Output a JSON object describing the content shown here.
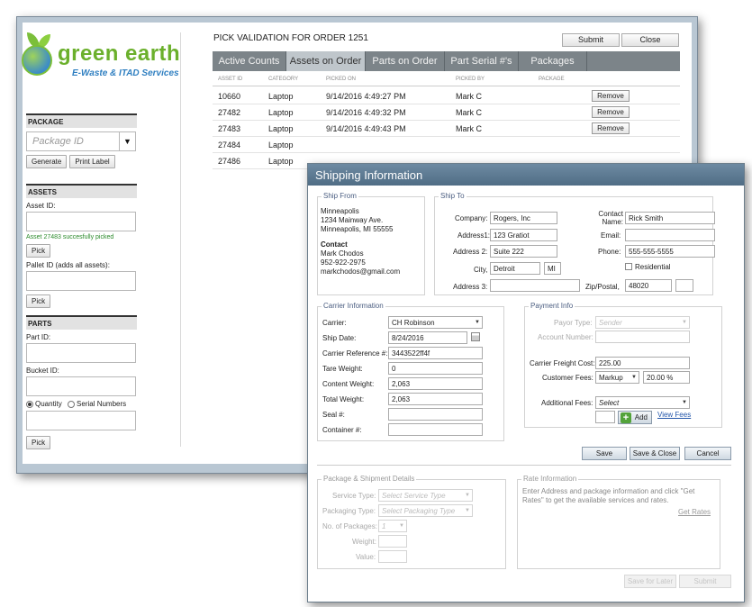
{
  "main": {
    "brand_name": "green earth",
    "brand_tagline": "E-Waste & ITAD Services",
    "order_title": "PICK VALIDATION FOR ORDER 1251",
    "submit_label": "Submit",
    "close_label": "Close",
    "tabs": [
      "Active Counts",
      "Assets on Order",
      "Parts on Order",
      "Part Serial #'s",
      "Packages"
    ],
    "grid_headers": [
      "ASSET ID",
      "CATEGORY",
      "PICKED ON",
      "PICKED BY",
      "PACKAGE"
    ],
    "remove_label": "Remove",
    "rows": [
      {
        "asset_id": "10660",
        "category": "Laptop",
        "picked_on": "9/14/2016 4:49:27 PM",
        "picked_by": "Mark C",
        "removable": true
      },
      {
        "asset_id": "27482",
        "category": "Laptop",
        "picked_on": "9/14/2016 4:49:32 PM",
        "picked_by": "Mark C",
        "removable": true
      },
      {
        "asset_id": "27483",
        "category": "Laptop",
        "picked_on": "9/14/2016 4:49:43 PM",
        "picked_by": "Mark C",
        "removable": true
      },
      {
        "asset_id": "27484",
        "category": "Laptop",
        "picked_on": "",
        "picked_by": "",
        "removable": false
      },
      {
        "asset_id": "27486",
        "category": "Laptop",
        "picked_on": "",
        "picked_by": "",
        "removable": false
      }
    ]
  },
  "sidebar": {
    "package": {
      "heading": "PACKAGE",
      "placeholder": "Package ID",
      "generate": "Generate",
      "print_label": "Print Label"
    },
    "assets": {
      "heading": "ASSETS",
      "asset_label": "Asset ID:",
      "success": "Asset 27483 succesfully picked",
      "pick": "Pick",
      "pallet_label": "Pallet ID (adds all assets):"
    },
    "parts": {
      "heading": "PARTS",
      "part_label": "Part ID:",
      "bucket_label": "Bucket ID:",
      "quantity": "Quantity",
      "serial": "Serial Numbers",
      "pick": "Pick"
    }
  },
  "dialog": {
    "title": "Shipping Information",
    "ship_from": {
      "title": "Ship From",
      "line1": "Minneapolis",
      "line2": "1234 Mainway Ave.",
      "line3": "Minneapolis, MI 55555",
      "contact_heading": "Contact",
      "contact_name": "Mark Chodos",
      "contact_phone": "952-922-2975",
      "contact_email": "markchodos@gmail.com"
    },
    "ship_to": {
      "title": "Ship To",
      "company_label": "Company:",
      "company": "Rogers, Inc",
      "contact_label": "Contact Name:",
      "contact": "Rick Smith",
      "address1_label": "Address1:",
      "address1": "123 Gratiot",
      "email_label": "Email:",
      "email": "",
      "address2_label": "Address 2:",
      "address2": "Suite 222",
      "phone_label": "Phone:",
      "phone": "555-555-5555",
      "city_label": "City,",
      "city": "Detroit",
      "state": "MI",
      "residential_label": "Residential",
      "address3_label": "Address 3:",
      "address3": "",
      "zip_label": "Zip/Postal,",
      "zip": "48020"
    },
    "carrier": {
      "title": "Carrier Information",
      "carrier_label": "Carrier:",
      "carrier": "CH Robinson",
      "ship_date_label": "Ship Date:",
      "ship_date": "8/24/2016",
      "ref_label": "Carrier Reference #:",
      "ref": "3443522ff4f",
      "tare_label": "Tare Weight:",
      "tare": "0",
      "content_label": "Content Weight:",
      "content": "2,063",
      "total_label": "Total Weight:",
      "total": "2,063",
      "seal_label": "Seal #:",
      "seal": "",
      "container_label": "Container #:",
      "container": ""
    },
    "payment": {
      "title": "Payment Info",
      "payor_label": "Payor Type:",
      "payor": "Sender",
      "account_label": "Account Number:",
      "account": "",
      "freight_label": "Carrier Freight Cost:",
      "freight": "225.00",
      "fees_label": "Customer Fees:",
      "fees_type": "Markup",
      "fees_value": "20.00 %",
      "additional_label": "Additional Fees:",
      "additional": "Select",
      "add_label": "Add",
      "view_fees": "View Fees"
    },
    "buttons": {
      "save": "Save",
      "save_close": "Save & Close",
      "cancel": "Cancel"
    },
    "package": {
      "title": "Package & Shipment Details",
      "service_label": "Service Type:",
      "service": "Select Service Type",
      "packaging_label": "Packaging Type:",
      "packaging": "Select Packaging Type",
      "num_label": "No. of Packages:",
      "num": "1",
      "weight_label": "Weight:",
      "value_label": "Value:"
    },
    "rate": {
      "title": "Rate Information",
      "text": "Enter Address and package information and click \"Get Rates\" to get the available services and rates.",
      "get_rates": "Get Rates"
    },
    "bottom_buttons": [
      "Save for Later",
      "Submit"
    ]
  }
}
